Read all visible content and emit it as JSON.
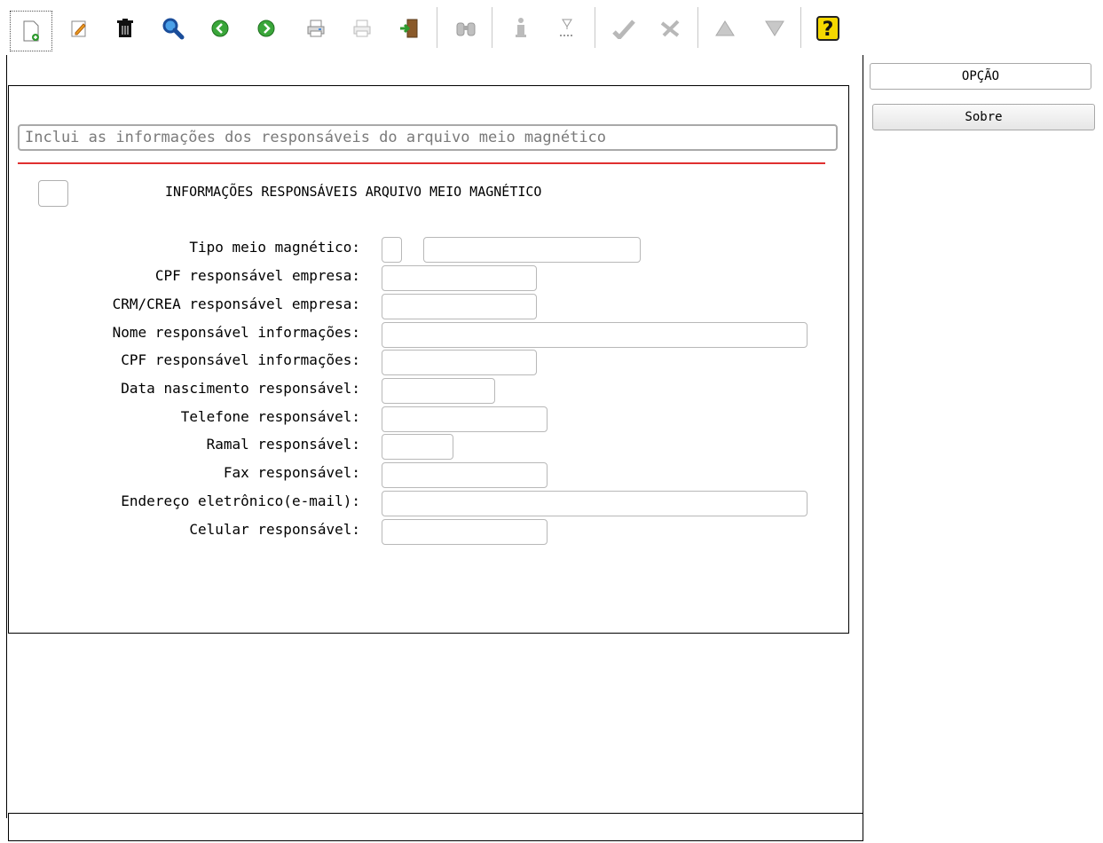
{
  "toolbar": {
    "icons": [
      "new-doc-icon",
      "edit-icon",
      "delete-icon",
      "search-icon",
      "previous-icon",
      "next-icon",
      "print-icon",
      "print-disabled-icon",
      "exit-icon",
      "binoculars-icon",
      "info-icon",
      "hourglass-icon",
      "check-icon",
      "cancel-icon",
      "up-icon",
      "down-icon",
      "help-icon"
    ]
  },
  "description": "Inclui as informações dos responsáveis do arquivo meio magnético",
  "section": {
    "title": "INFORMAÇÕES RESPONSÁVEIS ARQUIVO MEIO MAGNÉTICO"
  },
  "form": {
    "tipo_meio_label": "Tipo meio magnético:",
    "cpf_empresa_label": "CPF responsável empresa:",
    "crm_crea_label": "CRM/CREA responsável empresa:",
    "nome_resp_label": "Nome responsável informações:",
    "cpf_info_label": "CPF responsável informações:",
    "data_nasc_label": "Data nascimento responsável:",
    "telefone_label": "Telefone responsável:",
    "ramal_label": "Ramal responsável:",
    "fax_label": "Fax responsável:",
    "email_label": "Endereço eletrônico(e-mail):",
    "celular_label": "Celular responsável:"
  },
  "side_buttons": {
    "opcao": "OPÇÃO",
    "sobre": "Sobre"
  }
}
